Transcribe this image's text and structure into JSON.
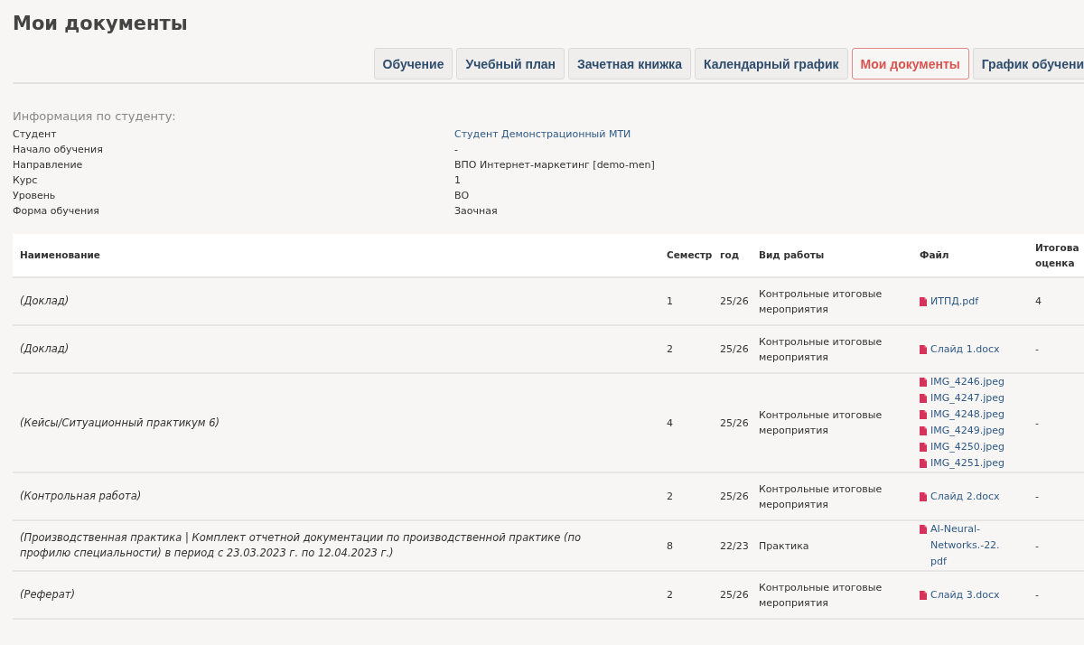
{
  "title": "Мои документы",
  "tabs": [
    {
      "label": "Обучение",
      "selected": false
    },
    {
      "label": "Учебный план",
      "selected": false
    },
    {
      "label": "Зачетная книжка",
      "selected": false
    },
    {
      "label": "Календарный график",
      "selected": false
    },
    {
      "label": "Мои документы",
      "selected": true
    },
    {
      "label": "График обучени",
      "selected": false
    }
  ],
  "student_info": {
    "heading": "Информация по студенту:",
    "fields": [
      {
        "label": "Студент",
        "value": "Студент Демонстрационный МТИ",
        "kind": "link"
      },
      {
        "label": "Начало обучения",
        "value": "-",
        "kind": "text"
      },
      {
        "label": "Направление",
        "value": "ВПО Интернет-маркетинг [demo-men]",
        "kind": "text"
      },
      {
        "label": "Курс",
        "value": "1",
        "kind": "text"
      },
      {
        "label": "Уровень",
        "value": "ВО",
        "kind": "text"
      },
      {
        "label": "Форма обучения",
        "value": "Заочная",
        "kind": "text"
      }
    ]
  },
  "documents": {
    "columns": [
      "Наименование",
      "Семестр",
      "год",
      "Вид работы",
      "Файл",
      "Итогова оценка"
    ],
    "rows": [
      {
        "name": "(Доклад)",
        "semester": "1",
        "year": "25/26",
        "work_type": "Контрольные итоговые мероприятия",
        "files": [
          "ИТПД.pdf"
        ],
        "grade": "4"
      },
      {
        "name": "(Доклад)",
        "semester": "2",
        "year": "25/26",
        "work_type": "Контрольные итоговые мероприятия",
        "files": [
          "Слайд 1.docx"
        ],
        "grade": "-"
      },
      {
        "name": "(Кейсы/Ситуационный практикум 6)",
        "semester": "4",
        "year": "25/26",
        "work_type": "Контрольные итоговые мероприятия",
        "files": [
          "IMG_4246.jpeg",
          "IMG_4247.jpeg",
          "IMG_4248.jpeg",
          "IMG_4249.jpeg",
          "IMG_4250.jpeg",
          "IMG_4251.jpeg"
        ],
        "grade": "-"
      },
      {
        "name": "(Контрольная работа)",
        "semester": "2",
        "year": "25/26",
        "work_type": "Контрольные итоговые мероприятия",
        "files": [
          "Слайд 2.docx"
        ],
        "grade": "-"
      },
      {
        "name": "(Производственная практика | Комплект отчетной документации по производственной практике (по профилю специальности) в период с 23.03.2023 г. по 12.04.2023 г.)",
        "semester": "8",
        "year": "22/23",
        "work_type": "Практика",
        "files": [
          "AI-Neural-Networks.-22.pdf"
        ],
        "grade": "-"
      },
      {
        "name": "(Реферат)",
        "semester": "2",
        "year": "25/26",
        "work_type": "Контрольные итоговые мероприятия",
        "files": [
          "Слайд 3.docx"
        ],
        "grade": "-"
      }
    ]
  }
}
